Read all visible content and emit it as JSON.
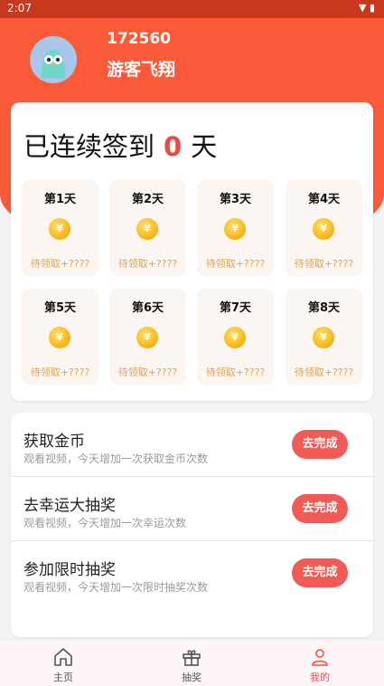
{
  "status_bar": {
    "time": "2:07"
  },
  "profile": {
    "user_id": "172560",
    "name": "游客飞翔"
  },
  "signin": {
    "prefix": "已连续签到",
    "count": "0",
    "suffix": "天",
    "days": [
      {
        "label": "第1天",
        "reward": "待领取+????"
      },
      {
        "label": "第2天",
        "reward": "待领取+????"
      },
      {
        "label": "第3天",
        "reward": "待领取+????"
      },
      {
        "label": "第4天",
        "reward": "待领取+????"
      },
      {
        "label": "第5天",
        "reward": "待领取+????"
      },
      {
        "label": "第6天",
        "reward": "待领取+????"
      },
      {
        "label": "第7天",
        "reward": "待领取+????"
      },
      {
        "label": "第8天",
        "reward": "待领取+????"
      }
    ],
    "coin_symbol": "¥"
  },
  "tasks": [
    {
      "title": "获取金币",
      "desc": "观看视频，今天增加一次获取金币次数",
      "button": "去完成"
    },
    {
      "title": "去幸运大抽奖",
      "desc": "观看视频，今天增加一次幸运次数",
      "button": "去完成"
    },
    {
      "title": "参加限时抽奖",
      "desc": "观看视频，今天增加一次限时抽奖次数",
      "button": "去完成"
    }
  ],
  "tabbar": {
    "items": [
      {
        "label": "主页",
        "icon": "home-icon"
      },
      {
        "label": "抽奖",
        "icon": "gift-icon"
      },
      {
        "label": "我的",
        "icon": "person-icon",
        "active": true
      }
    ]
  },
  "colors": {
    "brand": "#fb5a3a",
    "accent": "#f25b55",
    "reward": "#e4a150"
  }
}
